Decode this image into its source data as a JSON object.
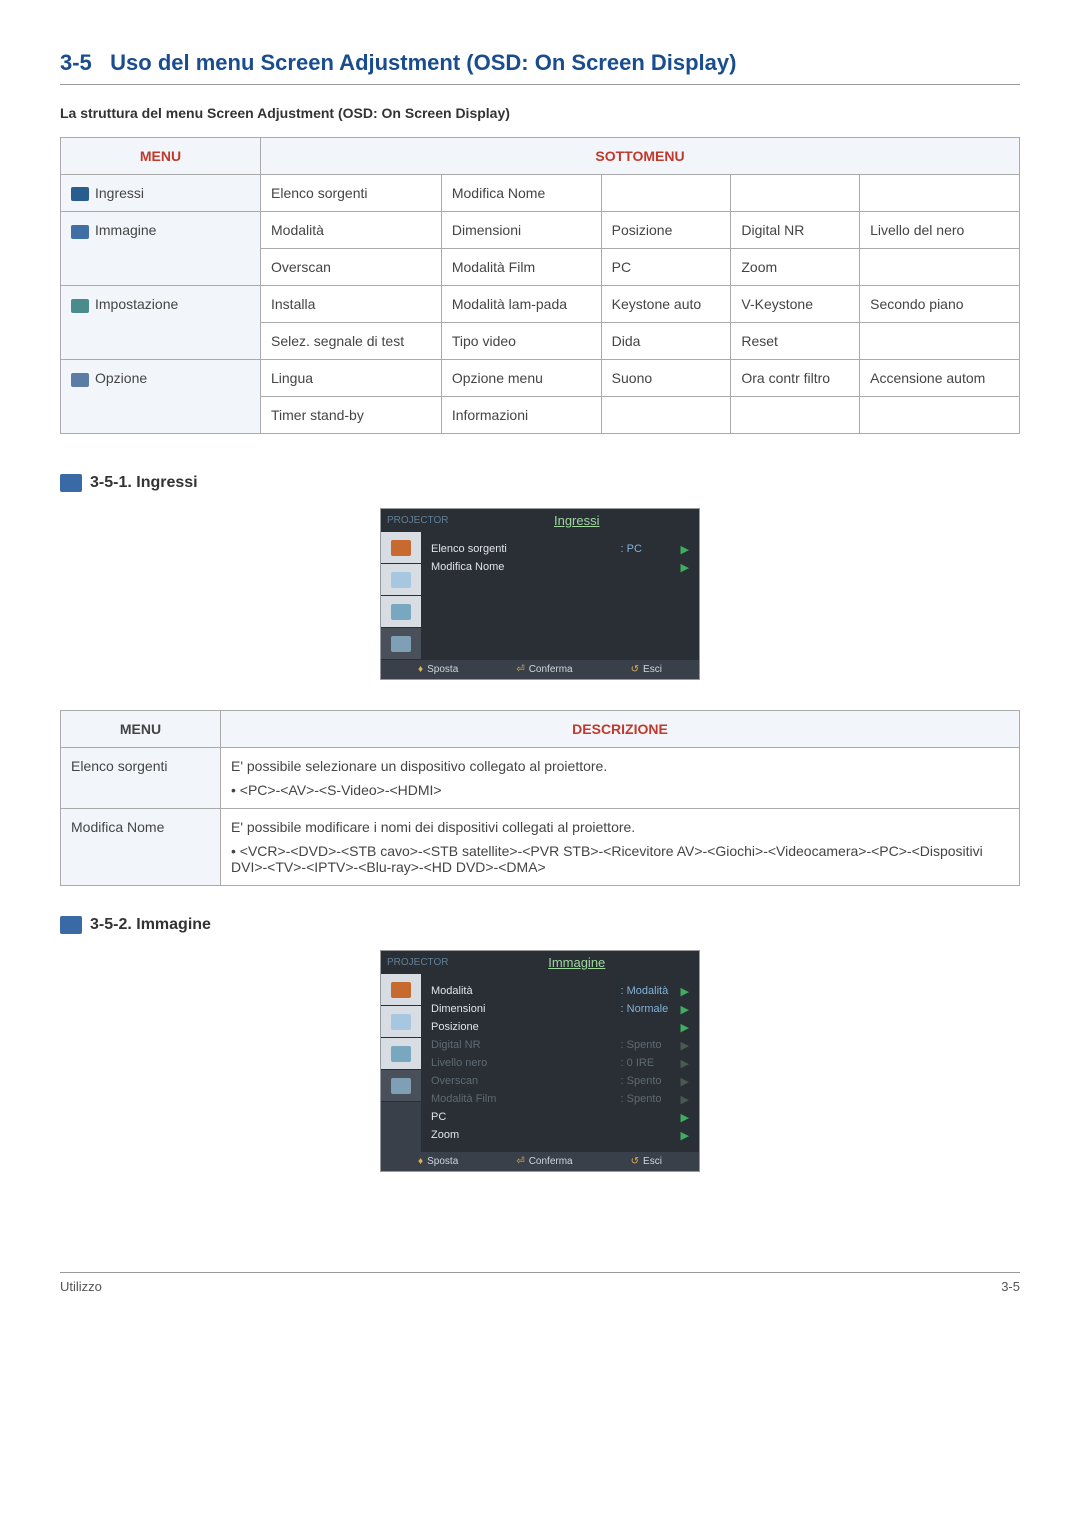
{
  "heading": {
    "number": "3-5",
    "title": "Uso del menu Screen Adjustment (OSD: On Screen Display)"
  },
  "structure_title": "La struttura del menu Screen Adjustment (OSD: On Screen Display)",
  "table1": {
    "headers": {
      "menu": "MENU",
      "sub": "SOTTOMENU"
    },
    "rows": [
      {
        "label": "Ingressi",
        "cells": [
          "Elenco sorgenti",
          "Modifica Nome",
          "",
          "",
          ""
        ]
      },
      {
        "label": "Immagine",
        "cells": [
          "Modalità",
          "Dimensioni",
          "Posizione",
          "Digital NR",
          "Livello del nero"
        ]
      },
      {
        "label": "",
        "cells": [
          "Overscan",
          "Modalità Film",
          "PC",
          "Zoom",
          ""
        ]
      },
      {
        "label": "Impostazione",
        "cells": [
          "Installa",
          "Modalità lam-pada",
          "Keystone auto",
          "V-Keystone",
          "Secondo piano"
        ]
      },
      {
        "label": "",
        "cells": [
          "Selez. segnale di test",
          "Tipo video",
          "Dida",
          "Reset",
          ""
        ]
      },
      {
        "label": "Opzione",
        "cells": [
          "Lingua",
          "Opzione menu",
          "Suono",
          "Ora contr filtro",
          "Accensione autom"
        ]
      },
      {
        "label": "",
        "cells": [
          "Timer stand-by",
          "Informazioni",
          "",
          "",
          ""
        ]
      }
    ]
  },
  "sub1": {
    "num": "3-5-1.",
    "title": "Ingressi"
  },
  "osd1": {
    "projector": "PROJECTOR",
    "title": "Ingressi",
    "rows": [
      {
        "label": "Elenco sorgenti",
        "value": ": PC"
      },
      {
        "label": "Modifica Nome",
        "value": ""
      }
    ],
    "footer": {
      "move": "Sposta",
      "confirm": "Conferma",
      "back": "Esci"
    }
  },
  "table2": {
    "headers": {
      "menu": "MENU",
      "desc": "DESCRIZIONE"
    },
    "rows": [
      {
        "label": "Elenco sorgenti",
        "text": "E' possibile selezionare un dispositivo collegato al proiettore.",
        "bullet": "<PC>-<AV>-<S-Video>-<HDMI>"
      },
      {
        "label": "Modifica Nome",
        "text": "E' possibile modificare i nomi dei dispositivi collegati al proiettore.",
        "bullet": "<VCR>-<DVD>-<STB cavo>-<STB satellite>-<PVR STB>-<Ricevitore AV>-<Giochi>-<Videocamera>-<PC>-<Dispositivi DVI>-<TV>-<IPTV>-<Blu-ray>-<HD DVD>-<DMA>"
      }
    ]
  },
  "sub2": {
    "num": "3-5-2.",
    "title": "Immagine"
  },
  "osd2": {
    "projector": "PROJECTOR",
    "title": "Immagine",
    "rows": [
      {
        "label": "Modalità",
        "value": ": Modalità",
        "dim": false
      },
      {
        "label": "Dimensioni",
        "value": ": Normale",
        "dim": false
      },
      {
        "label": "Posizione",
        "value": "",
        "dim": false
      },
      {
        "label": "Digital NR",
        "value": ": Spento",
        "dim": true
      },
      {
        "label": "Livello nero",
        "value": ": 0 IRE",
        "dim": true
      },
      {
        "label": "Overscan",
        "value": ": Spento",
        "dim": true
      },
      {
        "label": "Modalità Film",
        "value": ": Spento",
        "dim": true
      },
      {
        "label": "PC",
        "value": "",
        "dim": false
      },
      {
        "label": "Zoom",
        "value": "",
        "dim": false
      }
    ],
    "footer": {
      "move": "Sposta",
      "confirm": "Conferma",
      "back": "Esci"
    }
  },
  "footer": {
    "left": "Utilizzo",
    "right": "3-5"
  }
}
